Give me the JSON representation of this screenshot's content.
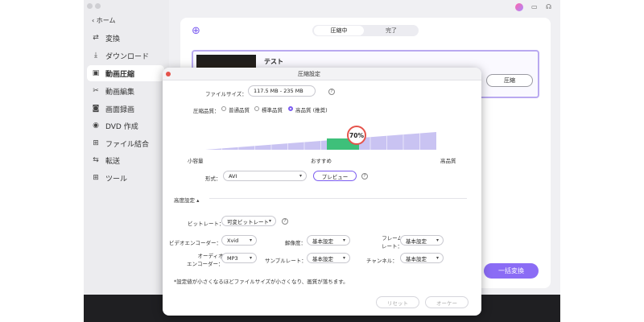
{
  "sidebar": {
    "home": "ホーム",
    "items": [
      {
        "label": "変換",
        "icon": "convert-icon"
      },
      {
        "label": "ダウンロード",
        "icon": "download-icon"
      },
      {
        "label": "動画圧縮",
        "icon": "compress-icon"
      },
      {
        "label": "動画編集",
        "icon": "scissors-icon"
      },
      {
        "label": "画面録画",
        "icon": "record-icon"
      },
      {
        "label": "DVD 作成",
        "icon": "dvd-icon"
      },
      {
        "label": "ファイル結合",
        "icon": "merge-icon"
      },
      {
        "label": "転送",
        "icon": "transfer-icon"
      },
      {
        "label": "ツール",
        "icon": "tools-icon"
      }
    ]
  },
  "tabs": {
    "compressing": "圧縮中",
    "done": "完了"
  },
  "file": {
    "name": "テスト",
    "compress_label": "圧縮"
  },
  "convert_all": "一括変換",
  "dialog": {
    "title": "圧縮設定",
    "file_size_label": "ファイルサイズ：",
    "file_size_value": "117.5 MB - 235 MB",
    "quality_label": "圧縮品質：",
    "quality_options": [
      "普通品質",
      "標準品質",
      "高品質 (推奨)"
    ],
    "quality_selected": 2,
    "slider_percent": "70%",
    "slider_value": 0.7,
    "slider_left": "小容量",
    "slider_mid": "おすすめ",
    "slider_right": "高品質",
    "format_label": "形式：",
    "format_value": "AVI",
    "preview_label": "プレビュー",
    "advanced_label": "高度設定",
    "bitrate_label": "ビットレート：",
    "bitrate_value": "可変ビットレート",
    "video_encoder_label": "ビデオエンコーダー：",
    "video_encoder_value": "Xvid",
    "resolution_label": "解像度：",
    "resolution_value": "基本設定",
    "frame_rate_label_1": "フレーム",
    "frame_rate_label_2": "レート：",
    "frame_rate_value": "基本設定",
    "audio_encoder_label_1": "オーディオ",
    "audio_encoder_label_2": "エンコーダー：",
    "audio_encoder_value": "MP3",
    "sample_rate_label": "サンプルレート：",
    "sample_rate_value": "基本設定",
    "channel_label": "チャンネル：",
    "channel_value": "基本設定",
    "note": "*設定値が小さくなるほどファイルサイズが小さくなり、画質が落ちます。",
    "reset_label": "リセット",
    "ok_label": "オーケー"
  },
  "colors": {
    "accent": "#7b5cf0",
    "slider_fill": "#c9c3f2",
    "slider_selected": "#3ec07a",
    "marker": "#e5534b"
  }
}
